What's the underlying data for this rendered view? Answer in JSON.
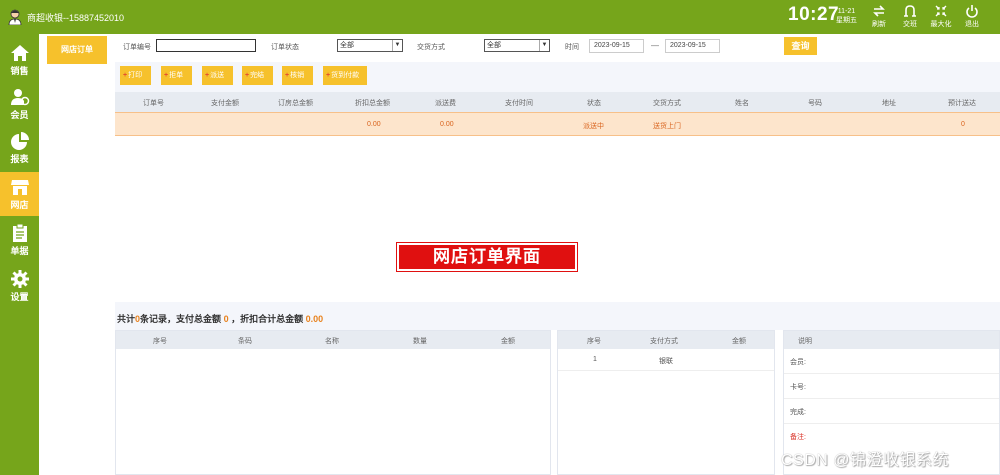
{
  "topbar": {
    "user_label": "商超收银--15887452010",
    "time": "10:27",
    "date": "11-21",
    "weekday": "星期五",
    "buttons": [
      {
        "label": "刷新",
        "icon": "refresh-icon"
      },
      {
        "label": "交班",
        "icon": "handover-icon"
      },
      {
        "label": "最大化",
        "icon": "maximize-icon"
      },
      {
        "label": "退出",
        "icon": "power-icon"
      }
    ]
  },
  "sidebar": {
    "items": [
      {
        "label": "销售",
        "icon": "home-icon"
      },
      {
        "label": "会员",
        "icon": "member-icon"
      },
      {
        "label": "报表",
        "icon": "pie-chart-icon"
      },
      {
        "label": "网店",
        "icon": "store-icon",
        "active": true
      },
      {
        "label": "单据",
        "icon": "clipboard-icon"
      },
      {
        "label": "设置",
        "icon": "gear-icon"
      }
    ]
  },
  "subpanel": {
    "tab_label": "网店订单"
  },
  "filter": {
    "order_no_label": "订单编号",
    "order_no_value": "",
    "status_label": "订单状态",
    "status_value": "全部",
    "trade_label": "交货方式",
    "trade_value": "全部",
    "time_label": "时间",
    "date_from": "2023-09-15",
    "date_sep": "—",
    "date_to": "2023-09-15",
    "query_label": "查询"
  },
  "actions": [
    {
      "label": "打印"
    },
    {
      "label": "拒单"
    },
    {
      "label": "派送"
    },
    {
      "label": "完结"
    },
    {
      "label": "核销"
    },
    {
      "label": "货到付款"
    }
  ],
  "orders_table": {
    "columns": [
      "订单号",
      "支付金额",
      "订房总金额",
      "折扣总金额",
      "派送费",
      "支付时间",
      "状态",
      "交货方式",
      "姓名",
      "号码",
      "地址",
      "预计送达"
    ],
    "rows": [
      {
        "order_no": "",
        "pay_amount": "",
        "total_amount": "",
        "discount_total": "0.00",
        "delivery_fee": "0.00",
        "pay_time": "",
        "status": "派送中",
        "trade": "送货上门",
        "name": "",
        "phone": "",
        "address": "",
        "eta": "0"
      }
    ]
  },
  "overlay_label": "网店订单界面",
  "summary": {
    "prefix": "共计",
    "count": "0",
    "mid1": "条记录，支付总金额",
    "pay_total": "0",
    "mid2": "，折扣合计总金额",
    "discount_total": "0.00"
  },
  "items_table": {
    "columns": [
      "序号",
      "条码",
      "名称",
      "数量",
      "金额"
    ]
  },
  "payment_table": {
    "columns": [
      "序号",
      "支付方式",
      "金额"
    ],
    "rows": [
      {
        "index": "1",
        "method": "银联",
        "amount": ""
      }
    ]
  },
  "info_panel": {
    "header": "说明",
    "rows": [
      {
        "label": "会员:"
      },
      {
        "label": "卡号:"
      },
      {
        "label": "完成:"
      },
      {
        "label": "备注:",
        "color": "#d93025"
      }
    ]
  },
  "watermark": "CSDN @锦澄收银系统",
  "colors": {
    "brand": "#76a51b",
    "accent": "#f6c12c",
    "highlight_row": "#fde5cc",
    "orange_text": "#d9641e",
    "overlay_red": "#e01010"
  }
}
